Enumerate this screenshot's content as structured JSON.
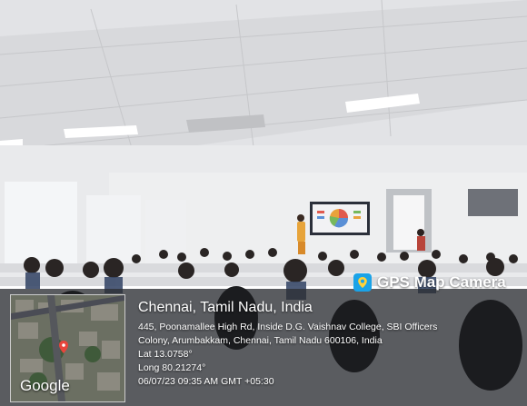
{
  "overlay": {
    "badge_label": "GPS Map Camera",
    "location_title": "Chennai, Tamil Nadu, India",
    "address_line1": "445, Poonamallee High Rd, Inside D.G. Vaishnav College, SBI Officers",
    "address_line2": "Colony, Arumbakkam, Chennai, Tamil Nadu 600106, India",
    "latitude": "Lat 13.0758°",
    "longitude": "Long 80.21274°",
    "timestamp": "06/07/23 09:35 AM GMT +05:30",
    "map_brand": "Google"
  },
  "colors": {
    "badge_icon": "#1aa3e8",
    "pin": "#e8453c"
  }
}
